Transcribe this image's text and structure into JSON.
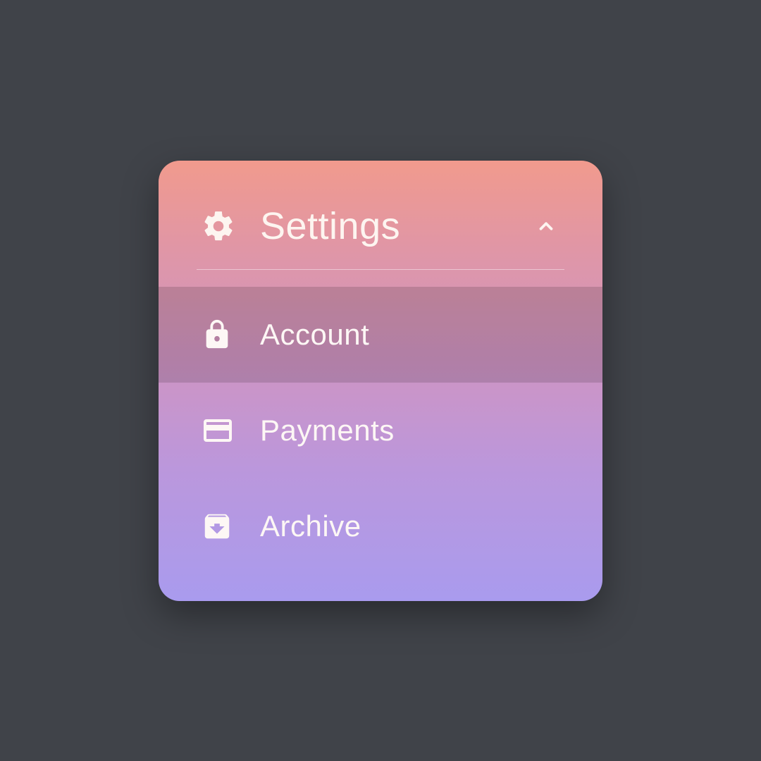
{
  "menu": {
    "header": {
      "label": "Settings",
      "icon": "gear-icon",
      "expanded": true
    },
    "items": [
      {
        "label": "Account",
        "icon": "lock-icon",
        "active": true
      },
      {
        "label": "Payments",
        "icon": "card-icon",
        "active": false
      },
      {
        "label": "Archive",
        "icon": "archive-icon",
        "active": false
      }
    ]
  },
  "colors": {
    "background": "#404349",
    "gradient_top": "#f19a8d",
    "gradient_bottom": "#a99bee",
    "text": "#fdf7f5"
  }
}
